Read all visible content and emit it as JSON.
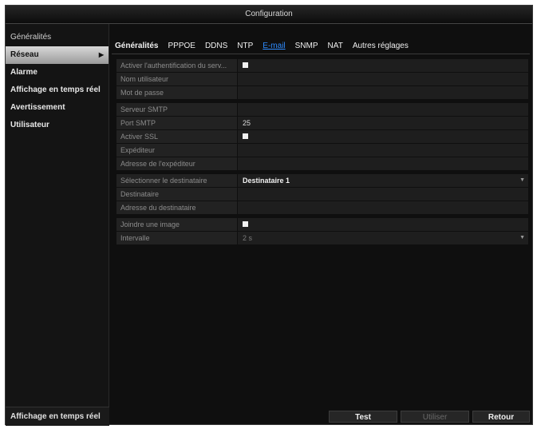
{
  "window": {
    "title": "Configuration"
  },
  "sidebar": {
    "items": [
      {
        "label": "Généralités"
      },
      {
        "label": "Réseau"
      },
      {
        "label": "Alarme"
      },
      {
        "label": "Affichage en temps réel"
      },
      {
        "label": "Avertissement"
      },
      {
        "label": "Utilisateur"
      }
    ],
    "active_index": 1,
    "bottom_label": "Affichage en temps réel"
  },
  "tabs": [
    {
      "label": "Généralités"
    },
    {
      "label": "PPPOE"
    },
    {
      "label": "DDNS"
    },
    {
      "label": "NTP"
    },
    {
      "label": "E-mail"
    },
    {
      "label": "SNMP"
    },
    {
      "label": "NAT"
    },
    {
      "label": "Autres réglages"
    }
  ],
  "active_tab": "E-mail",
  "form": {
    "auth": {
      "label": "Activer l'authentification du serv...",
      "checked": true
    },
    "username": {
      "label": "Nom utilisateur",
      "value": ""
    },
    "password": {
      "label": "Mot de passe",
      "value": ""
    },
    "smtp_server": {
      "label": "Serveur SMTP",
      "value": ""
    },
    "smtp_port": {
      "label": "Port SMTP",
      "value": "25"
    },
    "ssl": {
      "label": "Activer SSL",
      "checked": true
    },
    "sender": {
      "label": "Expéditeur",
      "value": ""
    },
    "sender_address": {
      "label": "Adresse de l'expéditeur",
      "value": ""
    },
    "select_recipient": {
      "label": "Sélectionner le destinataire",
      "value": "Destinataire 1"
    },
    "recipient": {
      "label": "Destinataire",
      "value": ""
    },
    "recipient_address": {
      "label": "Adresse du destinataire",
      "value": ""
    },
    "attach_image": {
      "label": "Joindre une image",
      "checked": true
    },
    "interval": {
      "label": "Intervalle",
      "value": "2 s"
    }
  },
  "buttons": {
    "test": "Test",
    "apply": "Utiliser",
    "back": "Retour"
  },
  "colors": {
    "accent": "#2f8cff",
    "background": "#0f0f0f",
    "row": "#222222"
  }
}
